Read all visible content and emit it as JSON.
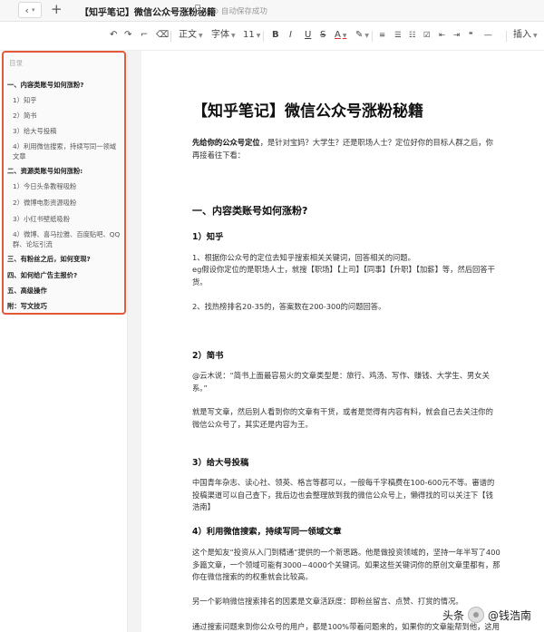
{
  "topbar": {
    "back_icon": "chevron-left",
    "new_tab_icon": "plus",
    "document_title": "【知乎笔记】微信公众号涨粉秘籍",
    "save_status": "⊙ 自动保存成功"
  },
  "toolbar": {
    "text_style": "正文",
    "font": "字体",
    "font_size": "11",
    "bold": "B",
    "italic": "I",
    "underline": "U",
    "strike": "S",
    "font_color": "A",
    "insert": "插入"
  },
  "outline": {
    "heading": "目录",
    "items": [
      {
        "label": "一、内容类账号如何涨粉?",
        "level": 1
      },
      {
        "label": "1）知乎",
        "level": 2
      },
      {
        "label": "2）简书",
        "level": 2
      },
      {
        "label": "3）给大号投稿",
        "level": 2
      },
      {
        "label": "4）利用微信搜索，持续写同一领域文章",
        "level": 2
      },
      {
        "label": "二、资源类账号如何涨粉:",
        "level": 1
      },
      {
        "label": "1）今日头条教程吸粉",
        "level": 2
      },
      {
        "label": "2）微博电影资源吸粉",
        "level": 2
      },
      {
        "label": "3）小红书壁纸吸粉",
        "level": 2
      },
      {
        "label": "4）微博、喜马拉雅、百度贴吧、QQ群、论坛引流",
        "level": 2
      },
      {
        "label": "三、有粉丝之后，如何变现?",
        "level": 1
      },
      {
        "label": "四、如何给广告主报价?",
        "level": 1
      },
      {
        "label": "五、高级操作",
        "level": 1
      },
      {
        "label": "附：写文技巧",
        "level": 1
      }
    ]
  },
  "document": {
    "title": "【知乎笔记】微信公众号涨粉秘籍",
    "intro_bold": "先给你的公众号定位",
    "intro_rest": "，是针对宝妈？大学生？还是职场人士？定位好你的目标人群之后，你再接着往下看：",
    "section1": "一、内容类账号如何涨粉?",
    "zhihu_heading": "1）知乎",
    "zhihu_p1": "1、根据你公众号的定位去知乎搜索相关关键词，回答相关的问题。",
    "zhihu_p2": "eg假设你定位的是职场人士，就搜【职场】【上司】【同事】【升职】【加薪】等，然后回答干货。",
    "zhihu_p3": "2、找热榜排名20-35的，答案数在200-300的问题回答。",
    "jianshu_heading": "2）简书",
    "jianshu_p1": "@云木说：“简书上面最容易火的文章类型是：旅行、鸡汤、写作、赚钱、大学生、男女关系。”",
    "jianshu_p2": "就是写文章，然后别人看到你的文章有干货，或者是觉得有内容有料，就会自己去关注你的微信公众号了，其实还是内容为王。",
    "tougao_heading": "3）给大号投稿",
    "tougao_p1": "中国青年杂志、读心社、领英、格言等都可以，一般每千字稿费在100-600元不等。審谱的投稿渠道可以自己查下，我后边也会整理放到我的微信公众号上，懒得找的可以关注下【钱浩南】",
    "search_heading": "4）利用微信搜索，持续写同一领域文章",
    "search_p1": "这个是知友“投资从入门到精通”提供的一个新思路。他是做投资领域的，坚持一年半写了400多篇文章，一个领域可能有3000~4000个关键词。如果这些关键词你的原创文章里都有，那你在微信搜索的的权重就会比较高。",
    "search_p2": "另一个影响微信搜索排名的因素是文章活跃度：即粉丝留言、点赞、打赏的情况。",
    "search_p3": "通过搜索问题来到你公众号的用户，都是100%带着问题来的，如果你的文章能帮到他，这用户"
  },
  "watermark": {
    "site": "头条",
    "author": "@钱浩南"
  }
}
